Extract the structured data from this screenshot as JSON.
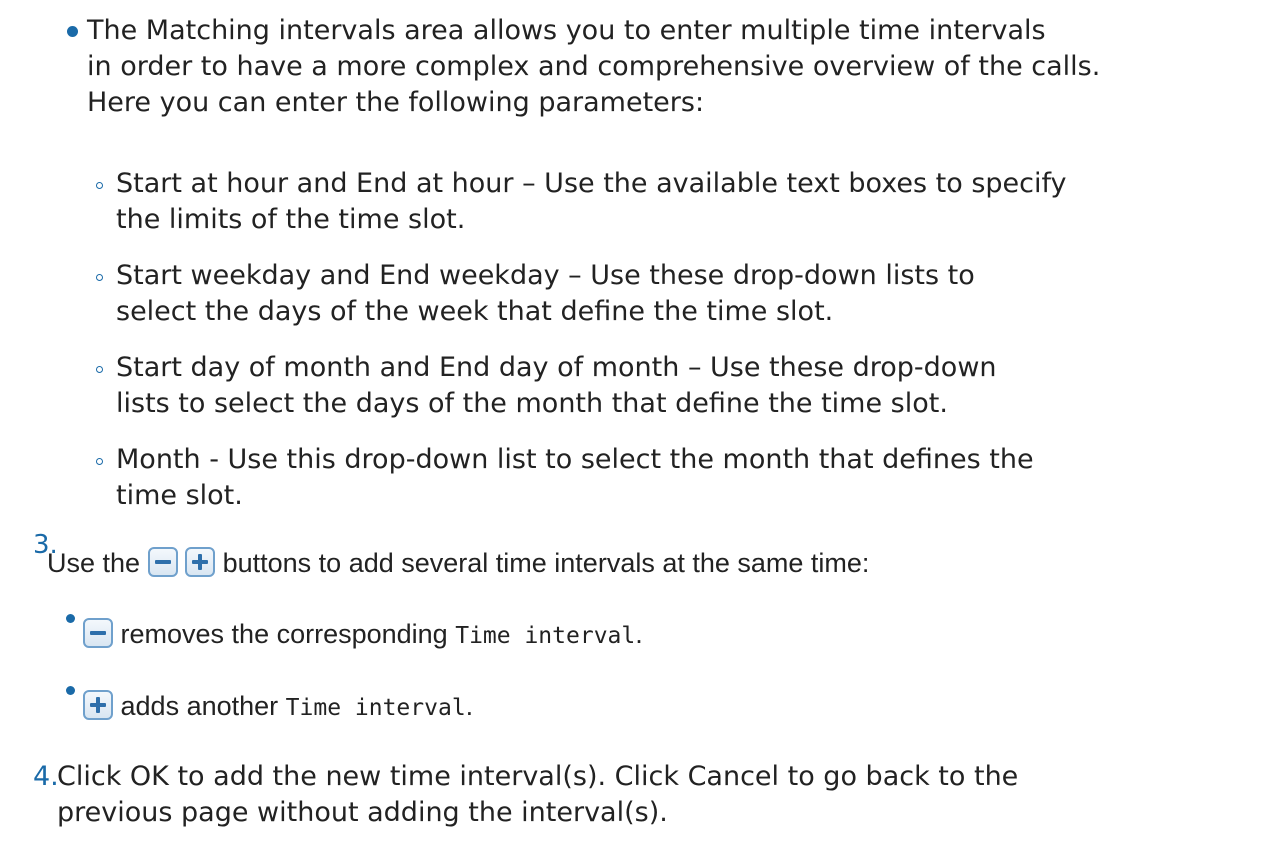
{
  "bullet_matching": {
    "line1": "The Matching intervals area allows you to enter multiple time intervals",
    "line2": "in order to have a more complex and comprehensive overview of the calls.",
    "line3": "Here you can enter the following parameters:"
  },
  "params": [
    {
      "line1": "Start at hour and End at hour – Use the available text boxes to specify",
      "line2": "the limits of the time slot."
    },
    {
      "line1": "Start weekday and End weekday – Use these drop-down lists to",
      "line2": "select the days of the week that define the time slot."
    },
    {
      "line1": "Start day of month and End day of month – Use these drop-down",
      "line2": "lists to select the days of the month that define the time slot."
    },
    {
      "line1": "Month - Use this drop-down list to select the month that defines the",
      "line2": "time slot."
    }
  ],
  "step3": {
    "number": "3.",
    "text_before": "Use the",
    "text_after": "buttons to add several time intervals at the same time:",
    "remove_text": "removes the corresponding",
    "remove_code": "Time interval",
    "remove_end": ".",
    "add_text": "adds another",
    "add_code": "Time interval",
    "add_end": "."
  },
  "step4": {
    "number": "4.",
    "line1": "Click OK to add the new time interval(s). Click Cancel to go back to the",
    "line2": "previous page without adding the interval(s)."
  },
  "icons": {
    "remove": "minus-button-icon",
    "add": "plus-button-icon"
  },
  "colors": {
    "accent": "#1a6aa8",
    "text": "#222222",
    "icon_border": "#6fa0cc"
  }
}
